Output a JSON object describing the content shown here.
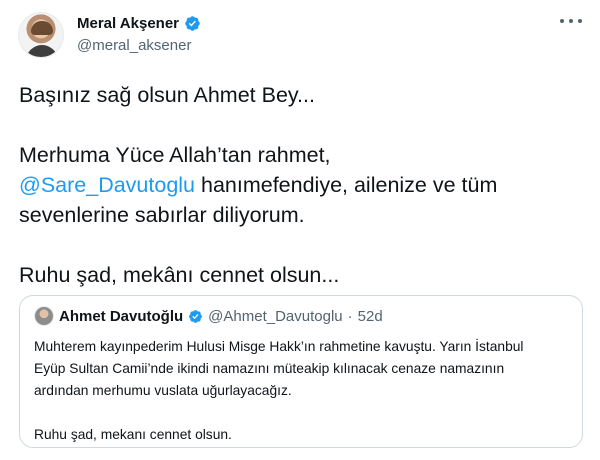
{
  "author": {
    "display_name": "Meral Akşener",
    "handle": "@meral_aksener",
    "verified_icon": "verified-badge-icon",
    "avatar_icon": "profile-photo"
  },
  "more_icon": "more-options-icon",
  "tweet": {
    "line1": "Başınız sağ olsun Ahmet Bey...",
    "line2": "Merhuma Yüce Allah’tan rahmet,",
    "mention": "@Sare_Davutoglu",
    "line3_rest": " hanımefendiye, ailenize ve tüm",
    "line4": "sevenlerine sabırlar diliyorum.",
    "line5": "Ruhu şad, mekânı cennet olsun..."
  },
  "quoted": {
    "display_name": "Ahmet Davutoğlu",
    "handle": "@Ahmet_Davutoglu",
    "separator": "·",
    "time": "52d",
    "line1": "Muhterem kayınpederim Hulusi Misge Hakk’ın rahmetine kavuştu. Yarın İstanbul",
    "line2": "Eyüp Sultan Camii’nde ikindi namazını müteakip kılınacak cenaze namazının",
    "line3": "ardından merhumu vuslata uğurlayacağız.",
    "line4": "Ruhu şad, mekanı cennet olsun."
  },
  "colors": {
    "link": "#1d9bf0",
    "verified": "#1d9bf0",
    "secondary_text": "#536471",
    "border": "#cfd9de"
  }
}
